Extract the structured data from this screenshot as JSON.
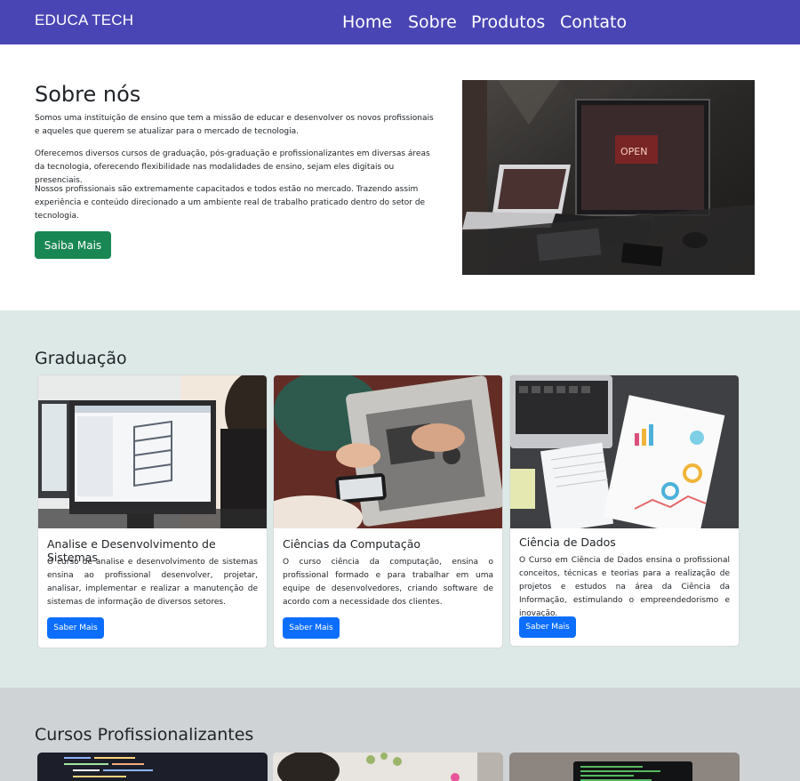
{
  "navbar": {
    "brand": "EDUCA TECH",
    "links": [
      "Home",
      "Sobre",
      "Produtos",
      "Contato"
    ]
  },
  "about": {
    "title": "Sobre nós",
    "paragraphs": [
      "Somos uma instituição de ensino que tem a missão de educar e desenvolver os novos profissionais e aqueles que querem se atualizar para o mercado de tecnologia.",
      "Oferecemos diversos cursos de graduação, pós-graduação e profissionalizantes em diversas áreas da tecnologia, oferecendo flexibilidade nas modalidades de ensino, sejam eles digitais ou presenciais.",
      "Nossos profissionais são extremamente capacitados e todos estão no mercado. Trazendo assim experiência e conteúdo direcionado a um ambiente real de trabalho praticado dentro do setor de tecnologia."
    ],
    "button": "Saiba Mais"
  },
  "graduacao": {
    "title": "Graduação",
    "cards": [
      {
        "title": "Analise e Desenvolvimento de Sistemas",
        "text": "O curso de analise e desenvolvimento de sistemas ensina ao profissional desenvolver, projetar, analisar, implementar e realizar a manutenção de sistemas de informação de diversos setores.",
        "button": "Saber Mais"
      },
      {
        "title": "Ciências da Computação",
        "text": "O curso ciência da computação, ensina o profissional formado e para trabalhar em uma equipe de desenvolvedores, criando software de acordo com a necessidade dos clientes.",
        "button": "Saber Mais"
      },
      {
        "title": "Ciência de Dados",
        "text": "O Curso em Ciência de Dados ensina o profissional conceitos, técnicas e teorias para a realização de projetos e estudos na área da Ciência da Informação, estimulando o empreendedorismo e inovação.",
        "button": "Saber Mais"
      }
    ]
  },
  "profissionalizantes": {
    "title": "Cursos Profissionalizantes"
  },
  "colors": {
    "navbar": "#4a45b4",
    "success": "#198754",
    "primary": "#0d6efd",
    "section_grad": "#dce9e7",
    "section_prof": "#cfd3d6"
  }
}
